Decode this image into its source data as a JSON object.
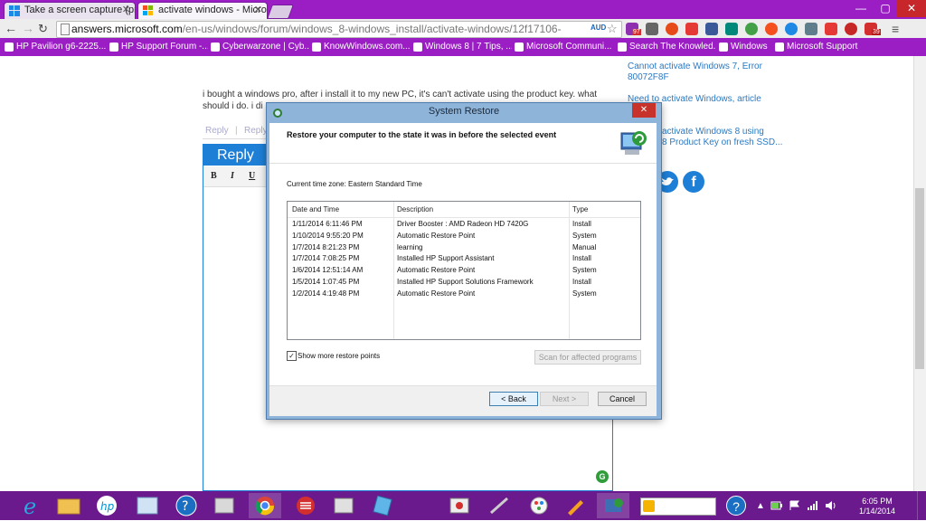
{
  "browser": {
    "tabs": [
      {
        "label": "Take a screen capture (pri"
      },
      {
        "label": "activate windows - Micro"
      }
    ],
    "window_controls": {
      "minimize": "—",
      "maximize": "▢",
      "close": "✕"
    },
    "address": {
      "domain": "answers.microsoft.com",
      "path": "/en-us/windows/forum/windows_8-windows_install/activate-windows/12f17106-"
    },
    "bookmarks": [
      "HP Pavilion g6-2225...",
      "HP Support Forum -...",
      "Cyberwarzone | Cyb...",
      "KnowWindows.com...",
      "Windows 8 | 7 Tips, ...",
      "Microsoft Communi...",
      "Search The Knowled...",
      "Windows",
      "Microsoft Support"
    ],
    "extension_badges": {
      "ext1": "97",
      "ext2": "39",
      "ext3": "AUD"
    }
  },
  "page": {
    "question_text": "i bought a windows pro, after i install it to my new PC, it's can't activate using the product key. what should i do. i di",
    "reply_links": [
      "Reply",
      "Reply"
    ],
    "reply_header": "Reply",
    "editor_tools": [
      "B",
      "I",
      "U"
    ],
    "sidebar_links": [
      "Cannot activate Windows 7, Error 80072F8F",
      "Need to activate Windows, article",
      "activate Windows 8 using",
      "8 Product Key on fresh SSD..."
    ]
  },
  "dialog": {
    "title": "System Restore",
    "heading": "Restore your computer to the state it was in before the selected event",
    "timezone": "Current time zone: Eastern Standard Time",
    "columns": [
      "Date and Time",
      "Description",
      "Type"
    ],
    "rows": [
      {
        "date": "1/11/2014 6:11:46 PM",
        "description": "Driver Booster : AMD Radeon HD 7420G",
        "type": "Install"
      },
      {
        "date": "1/10/2014 9:55:20 PM",
        "description": "Automatic Restore Point",
        "type": "System"
      },
      {
        "date": "1/7/2014 8:21:23 PM",
        "description": "learning",
        "type": "Manual"
      },
      {
        "date": "1/7/2014 7:08:25 PM",
        "description": "Installed HP Support Assistant",
        "type": "Install"
      },
      {
        "date": "1/6/2014 12:51:14 AM",
        "description": "Automatic Restore Point",
        "type": "System"
      },
      {
        "date": "1/5/2014 1:07:45 PM",
        "description": "Installed HP Support Solutions Framework",
        "type": "Install"
      },
      {
        "date": "1/2/2014 4:19:48 PM",
        "description": "Automatic Restore Point",
        "type": "System"
      }
    ],
    "show_more_label": "Show more restore points",
    "show_more_checked": true,
    "scan_button": "Scan for affected programs",
    "back_button": "< Back",
    "next_button": "Next >",
    "cancel_button": "Cancel"
  },
  "taskbar": {
    "time": "6:05 PM",
    "date": "1/14/2014"
  },
  "colors": {
    "chrome_theme": "#9a1ec4",
    "taskbar": "#6a1a8c",
    "reply_header": "#1e7fd6",
    "dialog_frame": "#8fb4da"
  }
}
